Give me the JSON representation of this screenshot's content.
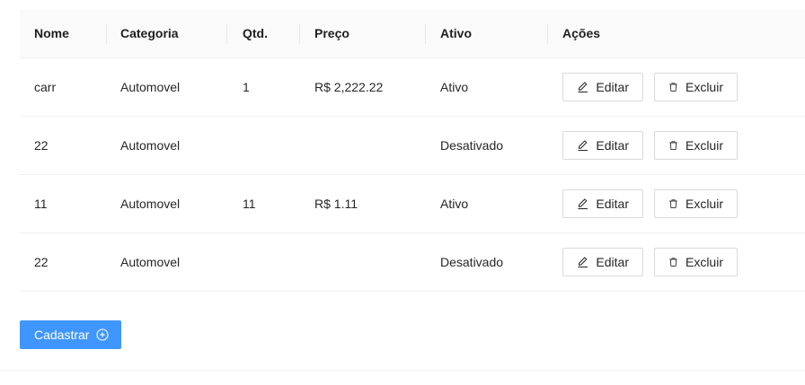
{
  "table": {
    "headers": {
      "nome": "Nome",
      "categoria": "Categoria",
      "qtd": "Qtd.",
      "preco": "Preço",
      "ativo": "Ativo",
      "acoes": "Ações"
    },
    "rows": [
      {
        "nome": "carr",
        "categoria": "Automovel",
        "qtd": "1",
        "preco": "R$ 2,222.22",
        "ativo": "Ativo"
      },
      {
        "nome": "22",
        "categoria": "Automovel",
        "qtd": "",
        "preco": "",
        "ativo": "Desativado"
      },
      {
        "nome": "11",
        "categoria": "Automovel",
        "qtd": "11",
        "preco": "R$ 1.11",
        "ativo": "Ativo"
      },
      {
        "nome": "22",
        "categoria": "Automovel",
        "qtd": "",
        "preco": "",
        "ativo": "Desativado"
      }
    ],
    "actions": {
      "edit_label": "Editar",
      "delete_label": "Excluir",
      "edit_icon": "edit-icon",
      "delete_icon": "trash-icon"
    }
  },
  "footer": {
    "register_label": "Cadastrar",
    "register_icon": "plus-circle-icon",
    "accent_color": "#4096ff"
  }
}
